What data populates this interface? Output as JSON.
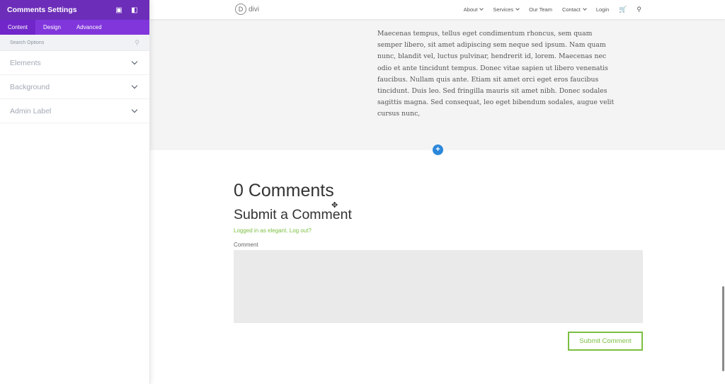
{
  "panel": {
    "title": "Comments Settings",
    "tabs": [
      "Content",
      "Design",
      "Advanced"
    ],
    "search_placeholder": "Search Options",
    "toggles": [
      "Elements",
      "Background",
      "Admin Label"
    ],
    "accent": "#6c2eb9"
  },
  "site": {
    "logo_mark": "D",
    "logo_text": "divi",
    "nav": {
      "about": "About",
      "services": "Services",
      "our_team": "Our Team",
      "contact": "Contact",
      "login": "Login"
    }
  },
  "post": {
    "text": "Maecenas tempus, tellus eget condimentum rhoncus, sem quam semper libero, sit amet adipiscing sem neque sed ipsum. Nam quam nunc, blandit vel, luctus pulvinar, hendrerit id, lorem. Maecenas nec odio et ante tincidunt tempus. Donec vitae sapien ut libero venenatis faucibus. Nullam quis ante. Etiam sit amet orci eget eros faucibus tincidunt. Duis leo. Sed fringilla mauris sit amet nibh. Donec sodales sagittis magna. Sed consequat, leo eget bibendum sodales, augue velit cursus nunc,"
  },
  "add_button": "+",
  "comments": {
    "count_title": "0 Comments",
    "submit_title": "Submit a Comment",
    "logged_in": "Logged in as elegant.",
    "log_out": "Log out?",
    "comment_label": "Comment",
    "textarea_value": "",
    "submit_label": "Submit Comment",
    "link_color": "#7cbf42"
  }
}
